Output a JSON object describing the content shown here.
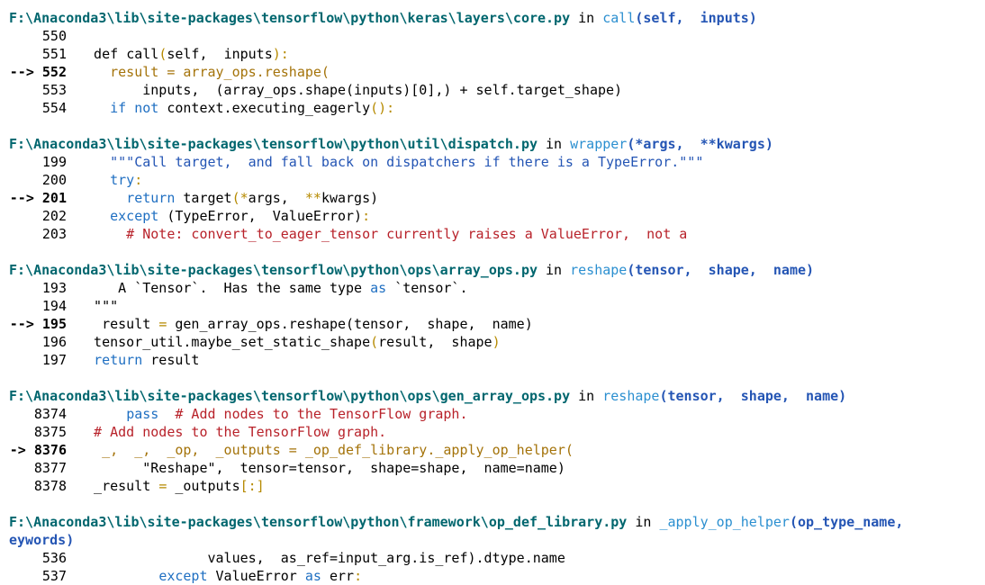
{
  "theme": {
    "path": "#00666e",
    "plain": "#000000",
    "function_name": "#2b8fd0",
    "args": "#2455b4",
    "keyword": "#1f6fc2",
    "string": "#2455b4",
    "comment": "#b8222a",
    "operator": "#b68a00",
    "highlight_line": "#a4730a"
  },
  "frames": [
    {
      "header": [
        {
          "t": "F:\\Anaconda3\\lib\\site-packages\\tensorflow\\python\\keras\\layers\\core.py",
          "c": "path"
        },
        {
          "t": " in ",
          "c": "plain"
        },
        {
          "t": "call",
          "c": "fn"
        },
        {
          "t": "(self,  inputs)",
          "c": "arg"
        }
      ],
      "lines": [
        {
          "num": "550",
          "arrow": false,
          "segs": []
        },
        {
          "num": "551",
          "arrow": false,
          "segs": [
            {
              "t": "  def ",
              "c": "plain"
            },
            {
              "t": "call",
              "c": "plain"
            },
            {
              "t": "(",
              "c": "op"
            },
            {
              "t": "self",
              "c": "plain"
            },
            {
              "t": ",  ",
              "c": "plain"
            },
            {
              "t": "inputs",
              "c": "plain"
            },
            {
              "t": "):",
              "c": "op"
            }
          ]
        },
        {
          "num": "552",
          "arrow": true,
          "segs": [
            {
              "t": "    result = array_ops.reshape(",
              "c": "hl"
            }
          ]
        },
        {
          "num": "553",
          "arrow": false,
          "segs": [
            {
              "t": "        inputs,  (array_ops.shape(inputs)[0],) + self.target_shape)",
              "c": "plain"
            }
          ]
        },
        {
          "num": "554",
          "arrow": false,
          "segs": [
            {
              "t": "    ",
              "c": "plain"
            },
            {
              "t": "if not ",
              "c": "kw"
            },
            {
              "t": "context.executing_eagerly",
              "c": "plain"
            },
            {
              "t": "():",
              "c": "op"
            }
          ]
        }
      ]
    },
    {
      "header": [
        {
          "t": "F:\\Anaconda3\\lib\\site-packages\\tensorflow\\python\\util\\dispatch.py",
          "c": "path"
        },
        {
          "t": " in ",
          "c": "plain"
        },
        {
          "t": "wrapper",
          "c": "fn"
        },
        {
          "t": "(*args,  **kwargs)",
          "c": "arg"
        }
      ],
      "lines": [
        {
          "num": "199",
          "arrow": false,
          "segs": [
            {
              "t": "    \"\"\"Call target,  and fall back on dispatchers if there is a TypeError.\"\"\"",
              "c": "str"
            }
          ]
        },
        {
          "num": "200",
          "arrow": false,
          "segs": [
            {
              "t": "    ",
              "c": "plain"
            },
            {
              "t": "try",
              "c": "kw"
            },
            {
              "t": ":",
              "c": "op"
            }
          ]
        },
        {
          "num": "201",
          "arrow": true,
          "segs": [
            {
              "t": "      ",
              "c": "plain"
            },
            {
              "t": "return ",
              "c": "kw"
            },
            {
              "t": "target",
              "c": "plain"
            },
            {
              "t": "(*",
              "c": "op"
            },
            {
              "t": "args,  ",
              "c": "plain"
            },
            {
              "t": "**",
              "c": "op"
            },
            {
              "t": "kwargs)",
              "c": "plain"
            }
          ]
        },
        {
          "num": "202",
          "arrow": false,
          "segs": [
            {
              "t": "    ",
              "c": "plain"
            },
            {
              "t": "except ",
              "c": "kw"
            },
            {
              "t": "(TypeError,  ValueError)",
              "c": "plain"
            },
            {
              "t": ":",
              "c": "op"
            }
          ]
        },
        {
          "num": "203",
          "arrow": false,
          "segs": [
            {
              "t": "      # Note: convert_to_eager_tensor currently raises a ValueError,  not a",
              "c": "cmt"
            }
          ]
        }
      ]
    },
    {
      "header": [
        {
          "t": "F:\\Anaconda3\\lib\\site-packages\\tensorflow\\python\\ops\\array_ops.py",
          "c": "path"
        },
        {
          "t": " in ",
          "c": "plain"
        },
        {
          "t": "reshape",
          "c": "fn"
        },
        {
          "t": "(tensor,  shape,  name)",
          "c": "arg"
        }
      ],
      "lines": [
        {
          "num": "193",
          "arrow": false,
          "segs": [
            {
              "t": "     A `Tensor`.  Has the same type ",
              "c": "plain"
            },
            {
              "t": "as",
              "c": "kw"
            },
            {
              "t": " `tensor`.",
              "c": "plain"
            }
          ]
        },
        {
          "num": "194",
          "arrow": false,
          "segs": [
            {
              "t": "  \"\"\"",
              "c": "plain"
            }
          ]
        },
        {
          "num": "195",
          "arrow": true,
          "segs": [
            {
              "t": "   result ",
              "c": "plain"
            },
            {
              "t": "= ",
              "c": "op"
            },
            {
              "t": "gen_array_ops.reshape(tensor,  shape,  name)",
              "c": "plain"
            }
          ]
        },
        {
          "num": "196",
          "arrow": false,
          "segs": [
            {
              "t": "  tensor_util.maybe_set_static_shape",
              "c": "plain"
            },
            {
              "t": "(",
              "c": "op"
            },
            {
              "t": "result,  shape",
              "c": "plain"
            },
            {
              "t": ")",
              "c": "op"
            }
          ]
        },
        {
          "num": "197",
          "arrow": false,
          "segs": [
            {
              "t": "  ",
              "c": "plain"
            },
            {
              "t": "return",
              "c": "kw"
            },
            {
              "t": " result",
              "c": "plain"
            }
          ]
        }
      ]
    },
    {
      "header": [
        {
          "t": "F:\\Anaconda3\\lib\\site-packages\\tensorflow\\python\\ops\\gen_array_ops.py",
          "c": "path"
        },
        {
          "t": " in ",
          "c": "plain"
        },
        {
          "t": "reshape",
          "c": "fn"
        },
        {
          "t": "(tensor,  shape,  name)",
          "c": "arg"
        }
      ],
      "lines": [
        {
          "num": "8374",
          "arrow": false,
          "segs": [
            {
              "t": "      ",
              "c": "plain"
            },
            {
              "t": "pass  ",
              "c": "kw"
            },
            {
              "t": "# Add nodes to the TensorFlow graph.",
              "c": "cmt"
            }
          ]
        },
        {
          "num": "8375",
          "arrow": false,
          "segs": [
            {
              "t": "  # Add nodes to the TensorFlow graph.",
              "c": "cmt"
            }
          ]
        },
        {
          "num": "8376",
          "arrow": true,
          "segs": [
            {
              "t": "   _,  _,  _op,  _outputs = _op_def_library._apply_op_helper(",
              "c": "hl"
            }
          ]
        },
        {
          "num": "8377",
          "arrow": false,
          "segs": [
            {
              "t": "        \"Reshape\",  tensor=tensor,  shape=shape,  name=name)",
              "c": "plain"
            }
          ]
        },
        {
          "num": "8378",
          "arrow": false,
          "segs": [
            {
              "t": "  _result ",
              "c": "plain"
            },
            {
              "t": "= ",
              "c": "op"
            },
            {
              "t": "_outputs",
              "c": "plain"
            },
            {
              "t": "[:]",
              "c": "op"
            }
          ]
        }
      ]
    },
    {
      "header": [
        {
          "t": "F:\\Anaconda3\\lib\\site-packages\\tensorflow\\python\\framework\\op_def_library.py",
          "c": "path"
        },
        {
          "t": " in ",
          "c": "plain"
        },
        {
          "t": "_apply_op_helper",
          "c": "fn"
        },
        {
          "t": "(op_type_name,",
          "c": "arg"
        }
      ],
      "header_cont": [
        {
          "t": "eywords)",
          "c": "arg"
        }
      ],
      "lines": [
        {
          "num": "536",
          "arrow": false,
          "segs": [
            {
              "t": "                values,  as_ref=input_arg.is_ref).dtype.name",
              "c": "plain"
            }
          ]
        },
        {
          "num": "537",
          "arrow": false,
          "segs": [
            {
              "t": "          ",
              "c": "plain"
            },
            {
              "t": "except ",
              "c": "kw"
            },
            {
              "t": "ValueError ",
              "c": "plain"
            },
            {
              "t": "as ",
              "c": "kw"
            },
            {
              "t": "err",
              "c": "plain"
            },
            {
              "t": ":",
              "c": "op"
            }
          ]
        }
      ]
    }
  ],
  "arrow_prefix": {
    "three_digit": "--> ",
    "four_digit": "-> "
  },
  "icons": []
}
